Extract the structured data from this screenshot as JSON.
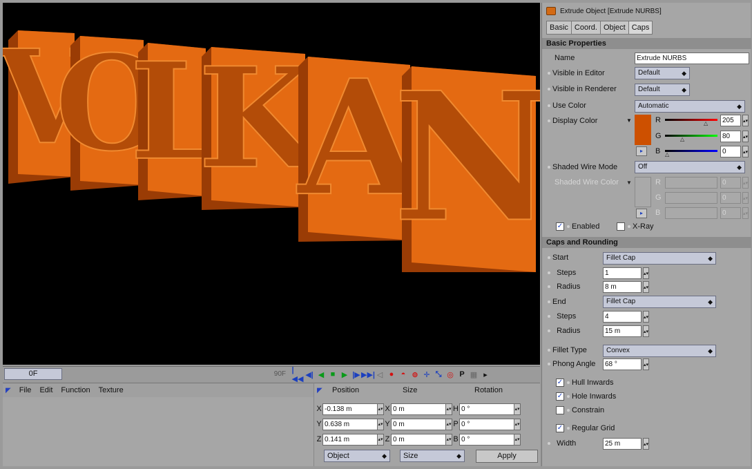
{
  "viewport": {
    "text": "VOLKAN",
    "letters": [
      "V",
      "O",
      "L",
      "K",
      "A",
      "N"
    ],
    "face_color": "#e46a12",
    "side_color": "#9a3c05"
  },
  "timeline": {
    "current_frame": "0F",
    "end_frame": "90F"
  },
  "material_manager": {
    "menu": [
      "File",
      "Edit",
      "Function",
      "Texture"
    ]
  },
  "coordinates": {
    "headers": {
      "position": "Position",
      "size": "Size",
      "rotation": "Rotation"
    },
    "rows": [
      {
        "pos_axis": "X",
        "pos": "-0.138 m",
        "size_axis": "X",
        "size": "0 m",
        "rot_axis": "H",
        "rot": "0 °"
      },
      {
        "pos_axis": "Y",
        "pos": "0.638 m",
        "size_axis": "Y",
        "size": "0 m",
        "rot_axis": "P",
        "rot": "0 °"
      },
      {
        "pos_axis": "Z",
        "pos": "0.141 m",
        "size_axis": "Z",
        "size": "0 m",
        "rot_axis": "B",
        "rot": "0 °"
      }
    ],
    "mode_object": "Object",
    "mode_size": "Size",
    "apply": "Apply"
  },
  "attributes": {
    "title": "Extrude Object [Extrude NURBS]",
    "tabs": [
      "Basic",
      "Coord.",
      "Object",
      "Caps"
    ],
    "basic_section": "Basic Properties",
    "name_label": "Name",
    "name_value": "Extrude NURBS",
    "visible_editor_label": "Visible in Editor",
    "visible_editor_value": "Default",
    "visible_renderer_label": "Visible in Renderer",
    "visible_renderer_value": "Default",
    "use_color_label": "Use Color",
    "use_color_value": "Automatic",
    "display_color_label": "Display Color",
    "color_r_label": "R",
    "color_r": "205",
    "color_g_label": "G",
    "color_g": "80",
    "color_b_label": "B",
    "color_b": "0",
    "shaded_wire_mode_label": "Shaded Wire Mode",
    "shaded_wire_mode_value": "Off",
    "shaded_wire_color_label": "Shaded Wire Color",
    "wire_r": "0",
    "wire_g": "0",
    "wire_b": "0",
    "enabled_label": "Enabled",
    "xray_label": "X-Ray",
    "caps_section": "Caps and Rounding",
    "start_label": "Start",
    "start_value": "Fillet Cap",
    "start_steps_label": "Steps",
    "start_steps": "1",
    "start_radius_label": "Radius",
    "start_radius": "8 m",
    "end_label": "End",
    "end_value": "Fillet Cap",
    "end_steps_label": "Steps",
    "end_steps": "4",
    "end_radius_label": "Radius",
    "end_radius": "15 m",
    "fillet_type_label": "Fillet Type",
    "fillet_type_value": "Convex",
    "phong_angle_label": "Phong Angle",
    "phong_angle": "68 °",
    "hull_inwards_label": "Hull Inwards",
    "hole_inwards_label": "Hole Inwards",
    "constrain_label": "Constrain",
    "regular_grid_label": "Regular Grid",
    "width_label": "Width",
    "width_value": "25 m",
    "display_color_hex": "#cd5000"
  }
}
